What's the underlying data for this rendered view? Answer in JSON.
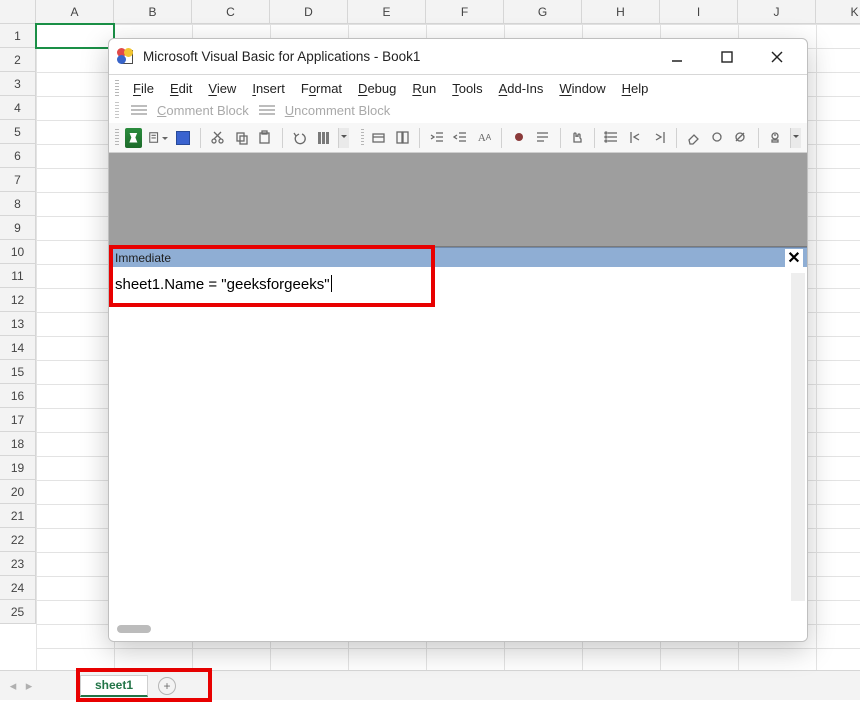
{
  "excel": {
    "columns": [
      "A",
      "B",
      "C",
      "D",
      "E",
      "F",
      "G",
      "H",
      "I",
      "J",
      "K"
    ],
    "rows": [
      "1",
      "2",
      "3",
      "4",
      "5",
      "6",
      "7",
      "8",
      "9",
      "10",
      "11",
      "12",
      "13",
      "14",
      "15",
      "16",
      "17",
      "18",
      "19",
      "20",
      "21",
      "22",
      "23",
      "24",
      "25"
    ],
    "sheet_tab": "sheet1"
  },
  "vba": {
    "title": "Microsoft Visual Basic for Applications - Book1",
    "menus": {
      "file": "File",
      "edit": "Edit",
      "view": "View",
      "insert": "Insert",
      "format": "Format",
      "debug": "Debug",
      "run": "Run",
      "tools": "Tools",
      "addins": "Add-Ins",
      "window": "Window",
      "help": "Help"
    },
    "comment_block": "Comment Block",
    "uncomment_block": "Uncomment Block",
    "immediate_title": "Immediate",
    "immediate_code": "sheet1.Name = \"geeksforgeeks\""
  }
}
